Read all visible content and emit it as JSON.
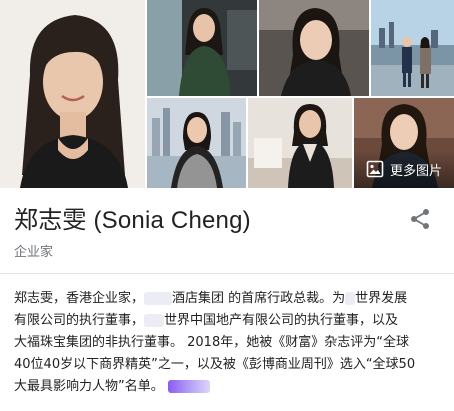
{
  "title": "郑志雯 (Sonia Cheng)",
  "subtitle": "企业家",
  "more_images_label": "更多图片",
  "description_lines": [
    [
      "郑志雯，香港企业家，",
      "酒店集团 的首席行政总裁。为",
      "世界发展"
    ],
    [
      "有限公司的执行董事，",
      "世界中国地产有限公司的执行董事，以及"
    ],
    [
      "大福珠宝集团的非执行董事。 2018年，她被《财富》杂志评为“全球"
    ],
    [
      "40位40岁以下商界精英”之一，以及被《彭博商业周刊》选入“全球50"
    ],
    [
      "大最具影响力人物”名单。"
    ]
  ],
  "icons": {
    "share": "share-icon",
    "images": "image-icon"
  },
  "colors": {
    "subtitle": "#70757a",
    "text": "#222222",
    "divider": "#e3e3e3"
  }
}
